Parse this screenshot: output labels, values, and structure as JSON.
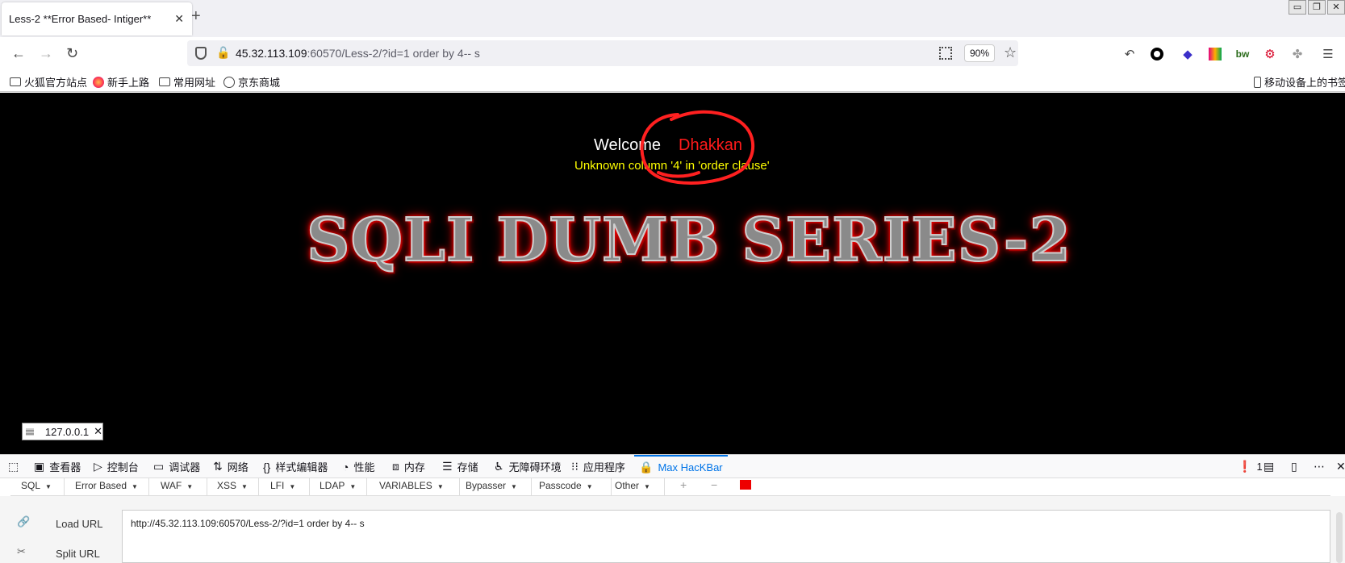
{
  "tab": {
    "title": "Less-2 **Error Based- Intiger**",
    "close": "✕",
    "new_tab": "+"
  },
  "window": {
    "minimize": "▭",
    "restore": "❐",
    "close": "✕"
  },
  "nav": {
    "back": "←",
    "forward": "→",
    "reload": "↻",
    "url_host": "45.32.113.109",
    "url_path": ":60570/Less-2/?id=1 order by 4-- s",
    "zoom": "90%",
    "menu": "☰"
  },
  "bookmarks": {
    "items": [
      "火狐官方站点",
      "新手上路",
      "常用网址",
      "京东商城"
    ],
    "mobile": "移动设备上的书签"
  },
  "page": {
    "welcome": "Welcome",
    "user": "Dhakkan",
    "error": "Unknown column '4' in 'order clause'",
    "banner": "SQLI DUMB SERIES-2",
    "ip": "127.0.0.1",
    "ip_close": "✕"
  },
  "devtools": {
    "tabs": [
      "查看器",
      "控制台",
      "调试器",
      "网络",
      "样式编辑器",
      "性能",
      "内存",
      "存储",
      "无障碍环境",
      "应用程序",
      "Max HacKBar"
    ],
    "error_count": "1"
  },
  "hackbar": {
    "menus": [
      "SQL",
      "Error Based",
      "WAF",
      "XSS",
      "LFI",
      "LDAP",
      "VARIABLES",
      "Bypasser",
      "Passcode",
      "Other"
    ],
    "load_url_label": "Load URL",
    "split_url_label": "Split URL",
    "url_value": "http://45.32.113.109:60570/Less-2/?id=1 order by 4-- s"
  },
  "colors": {
    "accent": "#0074e8",
    "error": "#ff1a1a",
    "warning": "#ffff00",
    "page_bg": "#000000"
  }
}
